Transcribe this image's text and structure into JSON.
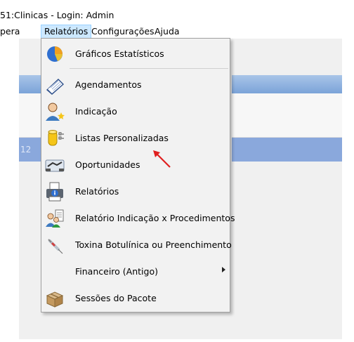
{
  "window": {
    "title": "51:Clinicas - Login: Admin"
  },
  "menubar": {
    "items": [
      "pera",
      "Relatórios",
      "Configurações",
      "Ajuda"
    ]
  },
  "background": {
    "partial_text": "12"
  },
  "menu": {
    "items": [
      {
        "label": "Gráficos Estatísticos",
        "icon": "pie-chart-icon"
      },
      {
        "label": "Agendamentos",
        "icon": "calendar-icon"
      },
      {
        "label": "Indicação",
        "icon": "user-star-icon"
      },
      {
        "label": "Listas Personalizadas",
        "icon": "database-list-icon"
      },
      {
        "label": "Oportunidades",
        "icon": "handshake-icon"
      },
      {
        "label": "Relatórios",
        "icon": "printer-info-icon"
      },
      {
        "label": "Relatório Indicação x Procedimentos",
        "icon": "users-document-icon"
      },
      {
        "label": "Toxina Botulínica ou Preenchimento",
        "icon": "syringe-icon"
      },
      {
        "label": "Financeiro (Antigo)",
        "icon": "",
        "has_submenu": true
      },
      {
        "label": "Sessões do Pacote",
        "icon": "package-icon"
      }
    ]
  },
  "colors": {
    "selection_highlight": "#cce8ff",
    "grid_band": "#8aa8dc",
    "annotation_arrow": "#e02020"
  }
}
